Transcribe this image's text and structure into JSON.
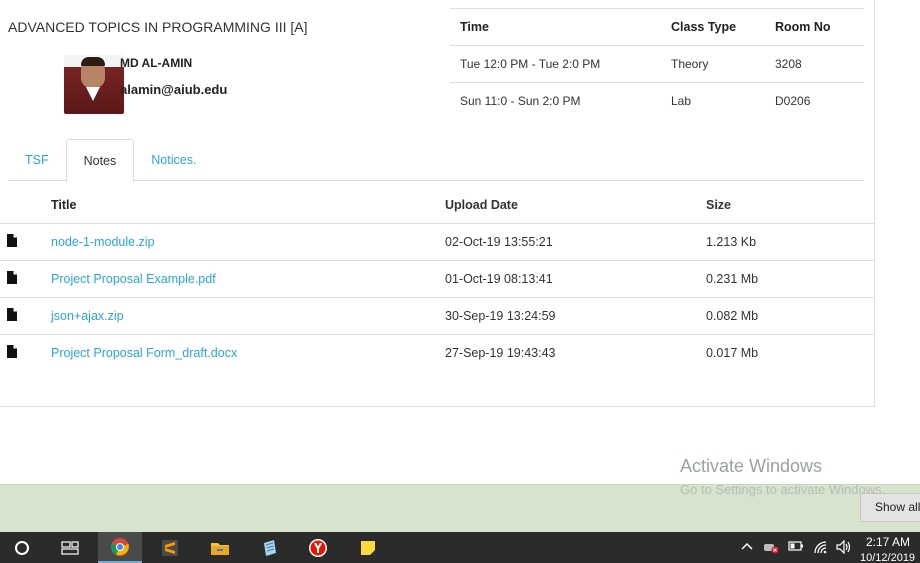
{
  "course": {
    "title": "ADVANCED TOPICS IN PROGRAMMING III [A]",
    "teacher_name": "MD AL-AMIN",
    "teacher_email": "alamin@aiub.edu"
  },
  "schedule": {
    "headers": {
      "time": "Time",
      "class_type": "Class Type",
      "room": "Room No"
    },
    "rows": [
      {
        "time": "Tue 12:0 PM - Tue 2:0 PM",
        "class_type": "Theory",
        "room": "3208"
      },
      {
        "time": "Sun 11:0 - Sun 2:0 PM",
        "class_type": "Lab",
        "room": "D0206"
      }
    ]
  },
  "tabs": [
    {
      "label": "TSF",
      "active": false
    },
    {
      "label": "Notes",
      "active": true
    },
    {
      "label": "Notices.",
      "active": false
    }
  ],
  "notes": {
    "headers": {
      "title": "Title",
      "upload_date": "Upload Date",
      "size": "Size"
    },
    "rows": [
      {
        "title": "node-1-module.zip",
        "upload_date": "02-Oct-19 13:55:21",
        "size": "1.213 Kb"
      },
      {
        "title": "Project Proposal Example.pdf",
        "upload_date": "01-Oct-19 08:13:41",
        "size": "0.231 Mb"
      },
      {
        "title": "json+ajax.zip",
        "upload_date": "30-Sep-19 13:24:59",
        "size": "0.082 Mb"
      },
      {
        "title": "Project Proposal Form_draft.docx",
        "upload_date": "27-Sep-19 19:43:43",
        "size": "0.017 Mb"
      }
    ]
  },
  "watermark": {
    "line1": "Activate Windows",
    "line2": "Go to Settings to activate Windows."
  },
  "download_bar": {
    "show_all": "Show all"
  },
  "taskbar": {
    "apps": [
      "cortana-icon",
      "task-view-icon",
      "chrome-icon",
      "sublime-icon",
      "file-explorer-icon",
      "notepad-icon",
      "yandex-icon",
      "sticky-notes-icon"
    ],
    "time": "2:17 AM",
    "date": "10/12/2019"
  },
  "colors": {
    "link": "#2aa6d8",
    "download_bar": "#d7e3cc",
    "taskbar": "#2b2b2b"
  }
}
